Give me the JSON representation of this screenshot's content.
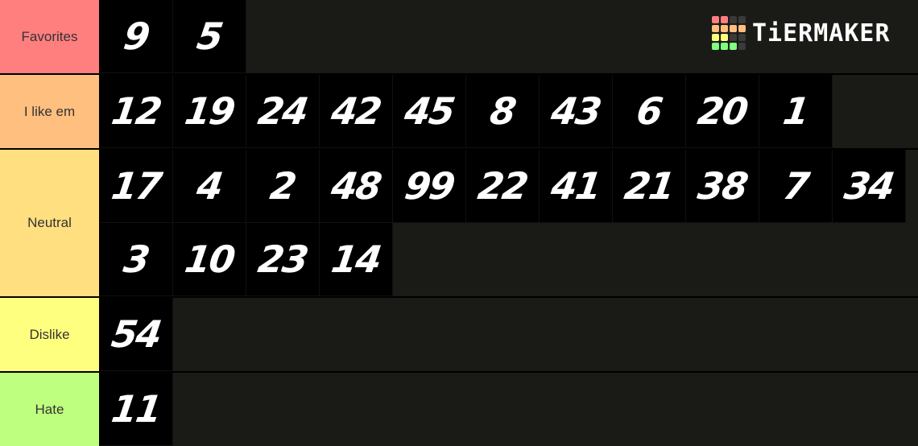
{
  "logo": {
    "text": "TiERMAKER",
    "grid_colors": [
      "#ff7f7f",
      "#ff7f7f",
      "#3a3a3a",
      "#3a3a3a",
      "#ffbf7f",
      "#ffbf7f",
      "#ffbf7f",
      "#ffbf7f",
      "#ffff7f",
      "#ffff7f",
      "#3a3a3a",
      "#3a3a3a",
      "#7fff7f",
      "#7fff7f",
      "#7fff7f",
      "#3a3a3a"
    ]
  },
  "tiers": [
    {
      "label": "Favorites",
      "color": "#ff7f7f",
      "items": [
        "9",
        "5"
      ]
    },
    {
      "label": "I like em",
      "color": "#ffbf7f",
      "items": [
        "12",
        "19",
        "24",
        "42",
        "45",
        "8",
        "43",
        "6",
        "20",
        "1"
      ]
    },
    {
      "label": "Neutral",
      "color": "#ffdf7f",
      "items": [
        "17",
        "4",
        "2",
        "48",
        "99",
        "22",
        "41",
        "21",
        "38",
        "7",
        "34",
        "3",
        "10",
        "23",
        "14"
      ]
    },
    {
      "label": "Dislike",
      "color": "#ffff7f",
      "items": [
        "54"
      ]
    },
    {
      "label": "Hate",
      "color": "#bfff7f",
      "items": [
        "11"
      ]
    }
  ]
}
